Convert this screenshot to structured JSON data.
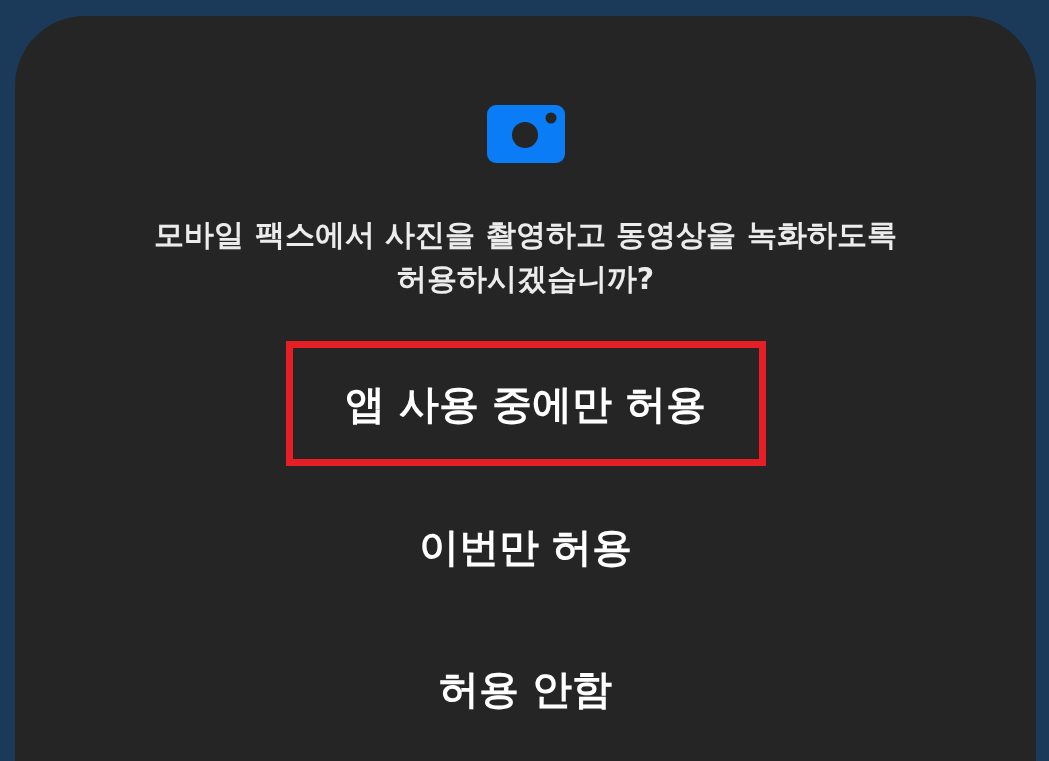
{
  "dialog": {
    "message": "모바일 팩스에서 사진을 촬영하고 동영상을 녹화하도록 허용하시겠습니까?",
    "options": [
      {
        "label": "앱 사용 중에만 허용",
        "highlighted": true
      },
      {
        "label": "이번만 허용",
        "highlighted": false
      },
      {
        "label": "허용 안함",
        "highlighted": false
      }
    ]
  }
}
